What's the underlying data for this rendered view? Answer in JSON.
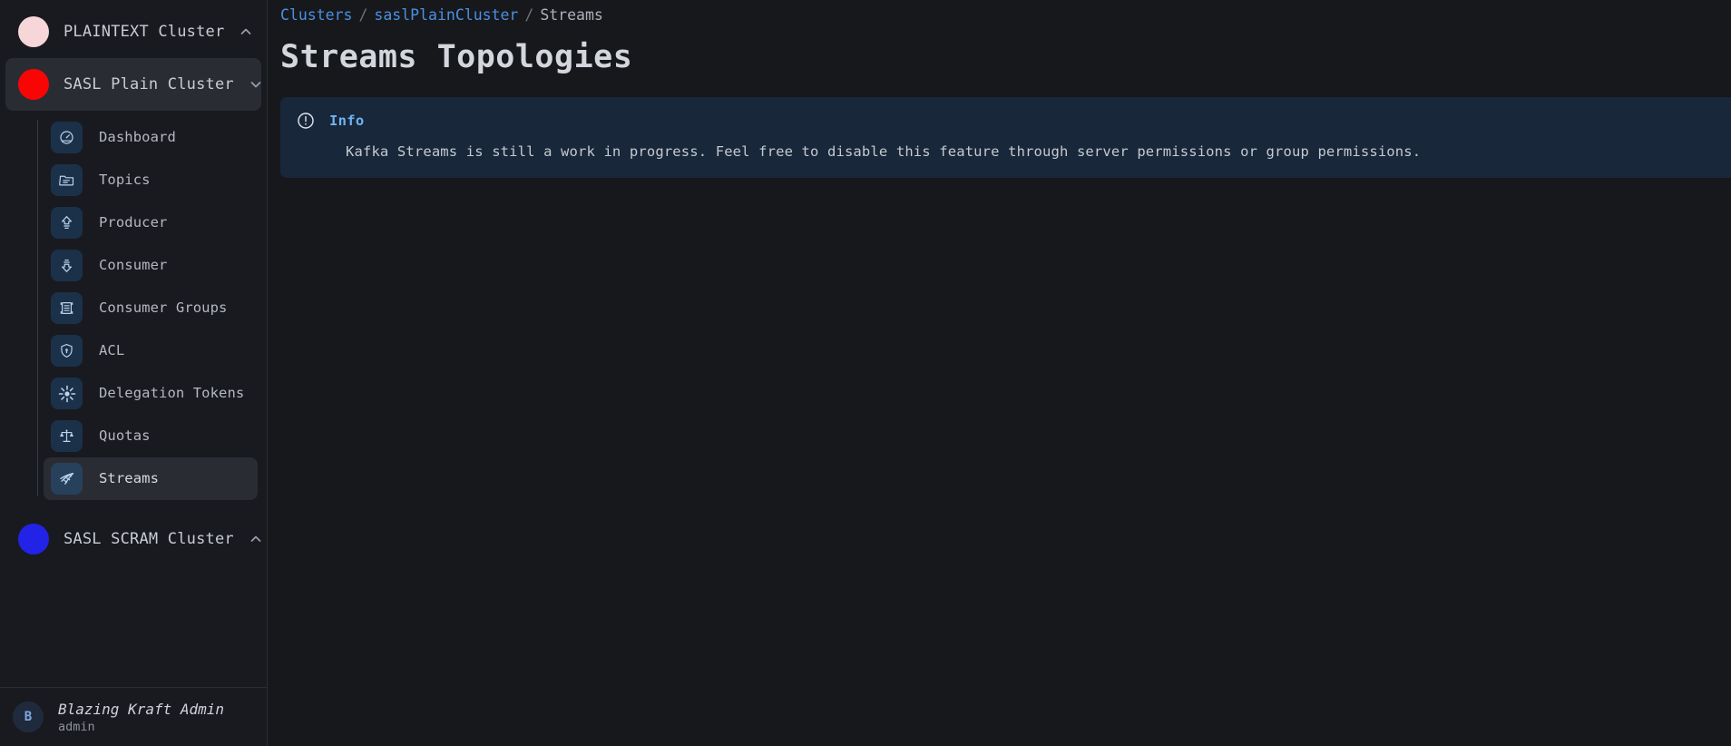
{
  "sidebar": {
    "clusters": [
      {
        "name": "PLAINTEXT Cluster",
        "dot_color": "#f6d6d8",
        "expanded": true,
        "chevron": "chevron-up"
      },
      {
        "name": "SASL Plain Cluster",
        "dot_color": "#fa0505",
        "expanded": false,
        "chevron": "chevron-down"
      }
    ],
    "nav_items": [
      {
        "label": "Dashboard",
        "icon": "gauge-icon",
        "active": false
      },
      {
        "label": "Topics",
        "icon": "folder-icon",
        "active": false
      },
      {
        "label": "Producer",
        "icon": "upload-arrow-icon",
        "active": false
      },
      {
        "label": "Consumer",
        "icon": "download-arrow-icon",
        "active": false
      },
      {
        "label": "Consumer Groups",
        "icon": "list-box-icon",
        "active": false
      },
      {
        "label": "ACL",
        "icon": "shield-lock-icon",
        "active": false
      },
      {
        "label": "Delegation Tokens",
        "icon": "asterisk-burst-icon",
        "active": false
      },
      {
        "label": "Quotas",
        "icon": "balance-scale-icon",
        "active": false
      },
      {
        "label": "Streams",
        "icon": "streams-flow-icon",
        "active": true
      }
    ],
    "bottom_cluster": {
      "name": "SASL SCRAM Cluster",
      "dot_color": "#2323e8",
      "chevron": "chevron-up"
    },
    "user": {
      "initial": "B",
      "name": "Blazing Kraft Admin",
      "role": "admin"
    }
  },
  "main": {
    "breadcrumb": {
      "root": "Clusters",
      "cluster": "saslPlainCluster",
      "current": "Streams",
      "separator": "/"
    },
    "title": "Streams Topologies",
    "alert": {
      "icon": "info-circle-icon",
      "title": "Info",
      "message": "Kafka Streams is still a work in progress. Feel free to disable this feature through server permissions or group permissions."
    }
  },
  "colors": {
    "accent_link": "#4a90e2",
    "alert_bg": "#18273a",
    "alert_title": "#6fb4f0",
    "sidebar_bg": "#191a1f",
    "main_bg": "#17181c"
  }
}
